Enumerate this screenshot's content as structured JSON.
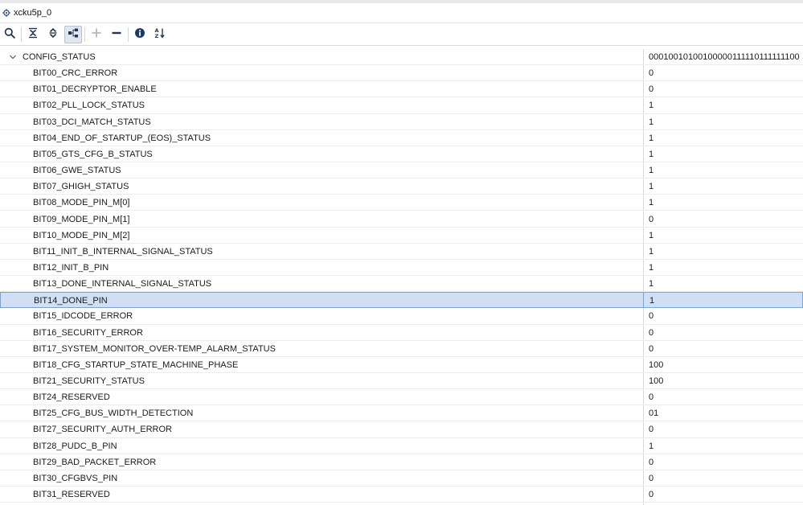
{
  "window": {
    "title": "xcku5p_0"
  },
  "toolbar": {
    "buttons": [
      {
        "icon": "search-icon"
      },
      {
        "icon": "collapse-all-icon"
      },
      {
        "icon": "expand-all-icon"
      },
      {
        "icon": "hierarchy-view-icon",
        "active": true
      },
      {
        "icon": "add-icon",
        "disabled": true
      },
      {
        "icon": "remove-icon"
      },
      {
        "icon": "info-icon"
      },
      {
        "icon": "sort-az-icon"
      }
    ]
  },
  "tree": {
    "root": {
      "name": "CONFIG_STATUS",
      "value": "00010010100100000111110111111100",
      "expanded": true
    },
    "selected_index": 14,
    "rows": [
      {
        "name": "BIT00_CRC_ERROR",
        "value": "0"
      },
      {
        "name": "BIT01_DECRYPTOR_ENABLE",
        "value": "0"
      },
      {
        "name": "BIT02_PLL_LOCK_STATUS",
        "value": "1"
      },
      {
        "name": "BIT03_DCI_MATCH_STATUS",
        "value": "1"
      },
      {
        "name": "BIT04_END_OF_STARTUP_(EOS)_STATUS",
        "value": "1"
      },
      {
        "name": "BIT05_GTS_CFG_B_STATUS",
        "value": "1"
      },
      {
        "name": "BIT06_GWE_STATUS",
        "value": "1"
      },
      {
        "name": "BIT07_GHIGH_STATUS",
        "value": "1"
      },
      {
        "name": "BIT08_MODE_PIN_M[0]",
        "value": "1"
      },
      {
        "name": "BIT09_MODE_PIN_M[1]",
        "value": "0"
      },
      {
        "name": "BIT10_MODE_PIN_M[2]",
        "value": "1"
      },
      {
        "name": "BIT11_INIT_B_INTERNAL_SIGNAL_STATUS",
        "value": "1"
      },
      {
        "name": "BIT12_INIT_B_PIN",
        "value": "1"
      },
      {
        "name": "BIT13_DONE_INTERNAL_SIGNAL_STATUS",
        "value": "1"
      },
      {
        "name": "BIT14_DONE_PIN",
        "value": "1"
      },
      {
        "name": "BIT15_IDCODE_ERROR",
        "value": "0"
      },
      {
        "name": "BIT16_SECURITY_ERROR",
        "value": "0"
      },
      {
        "name": "BIT17_SYSTEM_MONITOR_OVER-TEMP_ALARM_STATUS",
        "value": "0"
      },
      {
        "name": "BIT18_CFG_STARTUP_STATE_MACHINE_PHASE",
        "value": "100"
      },
      {
        "name": "BIT21_SECURITY_STATUS",
        "value": "100"
      },
      {
        "name": "BIT24_RESERVED",
        "value": "0"
      },
      {
        "name": "BIT25_CFG_BUS_WIDTH_DETECTION",
        "value": "01"
      },
      {
        "name": "BIT27_SECURITY_AUTH_ERROR",
        "value": "0"
      },
      {
        "name": "BIT28_PUDC_B_PIN",
        "value": "1"
      },
      {
        "name": "BIT29_BAD_PACKET_ERROR",
        "value": "0"
      },
      {
        "name": "BIT30_CFGBVS_PIN",
        "value": "0"
      },
      {
        "name": "BIT31_RESERVED",
        "value": "0"
      }
    ]
  },
  "colors": {
    "selection": "#cfe0f5",
    "accent": "#1f4e8c",
    "icon": "#2a3f5c"
  }
}
